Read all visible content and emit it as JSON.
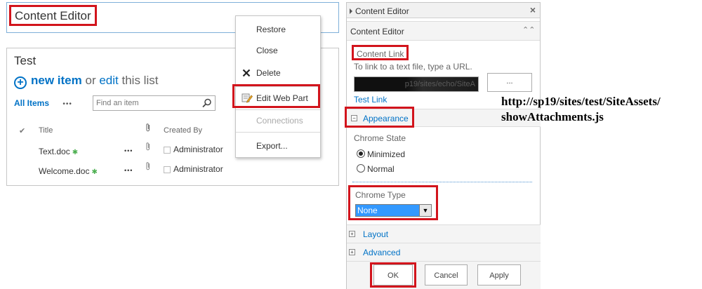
{
  "content_editor_webpart": {
    "title": "Content Editor"
  },
  "test_webpart": {
    "title": "Test",
    "new_item": "new item",
    "or": "or",
    "edit": "edit",
    "this_list": "this list",
    "view_all_items": "All Items",
    "more": "•••",
    "search_placeholder": "Find an item",
    "headers": {
      "title": "Title",
      "created_by": "Created By"
    },
    "rows": [
      {
        "title": "Text.doc",
        "new_mark": "✱",
        "ellipsis": "•••",
        "created_by": "Administrator"
      },
      {
        "title": "Welcome.doc",
        "new_mark": "✱",
        "ellipsis": "•••",
        "created_by": "Administrator"
      }
    ]
  },
  "context_menu": {
    "restore": "Restore",
    "close": "Close",
    "delete": "Delete",
    "edit_web_part": "Edit Web Part",
    "connections": "Connections",
    "export": "Export..."
  },
  "tool_pane": {
    "header_title": "Content Editor",
    "close_glyph": "×",
    "section_title": "Content Editor",
    "collapse_glyph": "⌃⌃",
    "content_link_label": "Content Link",
    "content_link_hint": "To link to a text file, type a URL.",
    "content_link_value": "p19/sites/echo/SiteA",
    "browse_label": "...",
    "test_link": "Test Link",
    "appearance_label": "Appearance",
    "appearance_toggle": "−",
    "chrome_state_label": "Chrome State",
    "chrome_state_options": [
      "Minimized",
      "Normal"
    ],
    "chrome_type_label": "Chrome Type",
    "chrome_type_value": "None",
    "layout_label": "Layout",
    "advanced_label": "Advanced",
    "expand_toggle": "+",
    "ok": "OK",
    "cancel": "Cancel",
    "apply": "Apply"
  },
  "annotation": {
    "line1": "http://sp19/sites/test/SiteAssets/",
    "line2": "showAttachments.js"
  },
  "colors": {
    "accent": "#0072c6",
    "highlight": "#d2141c",
    "selection": "#3399ff"
  }
}
